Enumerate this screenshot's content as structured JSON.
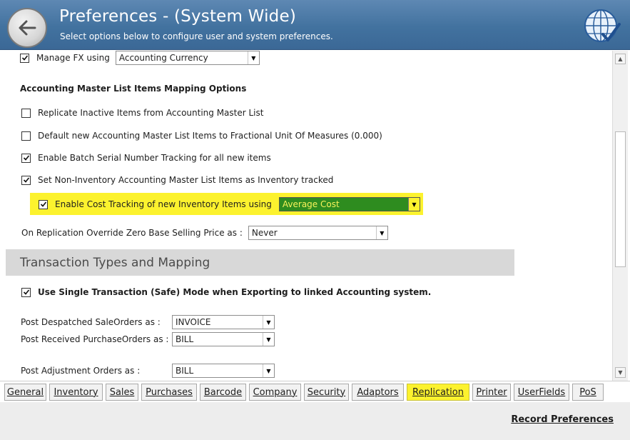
{
  "header": {
    "title": "Preferences - (System Wide)",
    "subtitle": "Select options below to configure user and system preferences."
  },
  "fx": {
    "label": "Manage FX using",
    "select_value": "Accounting Currency",
    "checked": true
  },
  "mapping": {
    "heading": "Accounting Master List Items Mapping Options",
    "options": [
      {
        "label": "Replicate Inactive Items from Accounting Master List",
        "checked": false
      },
      {
        "label": "Default new Accounting Master List Items to Fractional Unit Of Measures (0.000)",
        "checked": false
      },
      {
        "label": "Enable Batch Serial Number Tracking for all new items",
        "checked": true
      },
      {
        "label": "Set Non-Inventory Accounting Master List Items as Inventory tracked",
        "checked": true
      }
    ],
    "cost_tracking": {
      "label": "Enable Cost Tracking of new Inventory Items using",
      "select_value": "Average Cost",
      "checked": true,
      "select_color": "#2e8c1f"
    },
    "override": {
      "label": "On Replication Override Zero Base Selling Price as :",
      "select_value": "Never"
    }
  },
  "transactions": {
    "section_title": "Transaction Types and Mapping",
    "single_mode": {
      "label": "Use Single Transaction (Safe) Mode when Exporting to linked Accounting system.",
      "checked": true
    },
    "post_sale": {
      "label": "Post Despatched SaleOrders as :",
      "select_value": "INVOICE"
    },
    "post_purchase": {
      "label": "Post Received PurchaseOrders as :",
      "select_value": "BILL"
    },
    "post_adjust": {
      "label": "Post Adjustment Orders as :",
      "select_value": "BILL"
    }
  },
  "tabs": [
    {
      "label": "General",
      "active": false
    },
    {
      "label": "Inventory",
      "active": false
    },
    {
      "label": "Sales",
      "active": false
    },
    {
      "label": "Purchases",
      "active": false
    },
    {
      "label": "Barcode",
      "active": false
    },
    {
      "label": "Company",
      "active": false
    },
    {
      "label": "Security",
      "active": false
    },
    {
      "label": "Adaptors",
      "active": false
    },
    {
      "label": "Replication",
      "active": true
    },
    {
      "label": "Printer",
      "active": false
    },
    {
      "label": "UserFields",
      "active": false
    },
    {
      "label": "PoS",
      "active": false
    }
  ],
  "footer": {
    "record_label": "Record Preferences"
  },
  "colors": {
    "header": "#42729f",
    "highlight": "#fcf22e"
  }
}
